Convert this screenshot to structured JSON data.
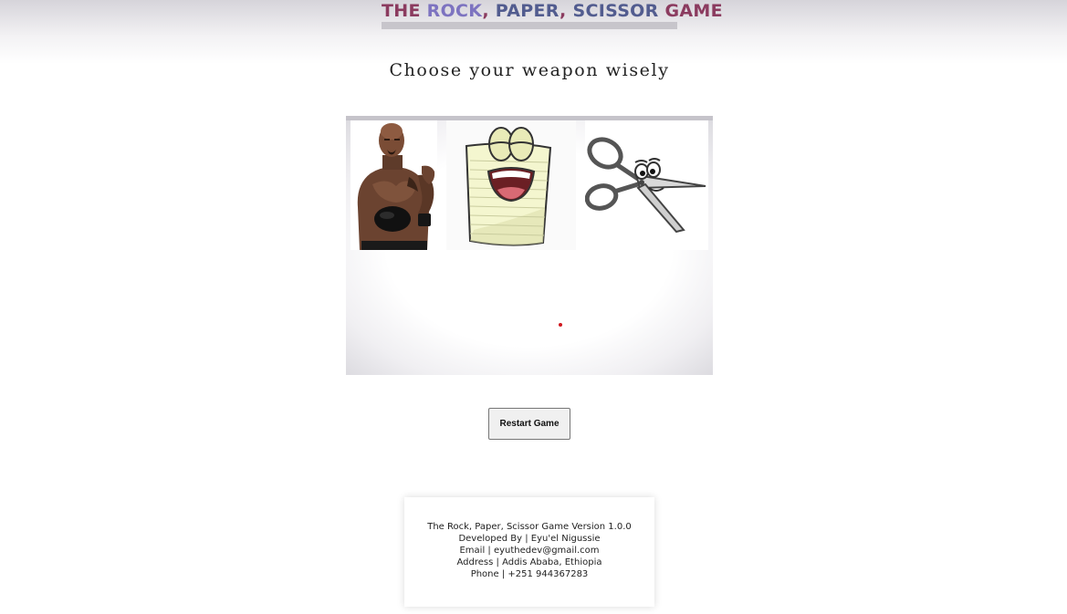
{
  "header": {
    "title_parts": [
      "THE ",
      "ROCK",
      ", ",
      "PAPER",
      ", ",
      "SCISSOR",
      " ",
      "GAME"
    ],
    "subtitle": "Choose your weapon wisely"
  },
  "weapons": [
    {
      "name": "rock",
      "icon": "rock-wrestler-photo"
    },
    {
      "name": "paper",
      "icon": "smiling-paper-cartoon"
    },
    {
      "name": "scissor",
      "icon": "smiling-scissors-cartoon"
    }
  ],
  "colors": {
    "title_the": "#8b3b5f",
    "title_rock": "#7d73c0",
    "title_paper": "#525c8f",
    "title_game": "#8b3b5f",
    "result_dot": "#d0181f"
  },
  "controls": {
    "restart_label": "Restart Game"
  },
  "footer": {
    "version": "The Rock, Paper, Scissor Game Version 1.0.0",
    "developer": "Developed By | Eyu'el Nigussie",
    "email": "Email | eyuthedev@gmail.com",
    "address": "Address | Addis Ababa, Ethiopia",
    "phone": "Phone | +251 944367283"
  }
}
